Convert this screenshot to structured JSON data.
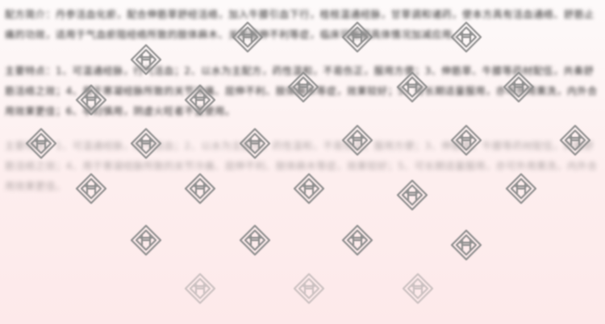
{
  "document": {
    "paragraphs": [
      {
        "name": "intro-paragraph",
        "text": "配方简介：丹参活血化瘀，配合伸筋草舒经活络，加入牛膝引血下行，桂枝温通经脉，甘草调和诸药，使本方具有活血通络、舒筋止痛的功效，适用于气血瘀阻经络所致的肢体麻木、关节屈伸不利等症，临床可根据具体情况加减应用。"
      },
      {
        "name": "features-paragraph",
        "text": "主要特点：1、可温通经脉，行气活血；2、以水为主配方，药性温和，不易伤正，服用方便；3、伸筋草、牛膝等药材配伍，共奏舒筋活络之效；4、用于寒凝经脉所致的关节冷痛、屈伸不利、肢体麻木等症，效果较好；5、可长期适量服用，亦可外用熏洗，内外合用效果更佳；6、孕妇慎用，阴虚火旺者不宜使用。"
      },
      {
        "name": "features-paragraph-faded",
        "text": "主要特点：1、可温通经脉，行气活血；2、以水为主配方，药性温和，不易伤正，服用方便；3、伸筋草、牛膝等药材配伍，共奏舒筋活络之效；4、用于寒凝经脉所致的关节冷痛、屈伸不利、肢体麻木等症，效果较好；5、可长期适量服用，亦可外用熏洗，内外合用效果更佳。"
      }
    ]
  },
  "watermark": {
    "icon": "seal-logo-icon",
    "color": "#8f8f8f",
    "count": 24
  },
  "colors": {
    "background_top": "#fdfafa",
    "background_bottom": "#fde9ea",
    "text": "#2a2a2a"
  }
}
